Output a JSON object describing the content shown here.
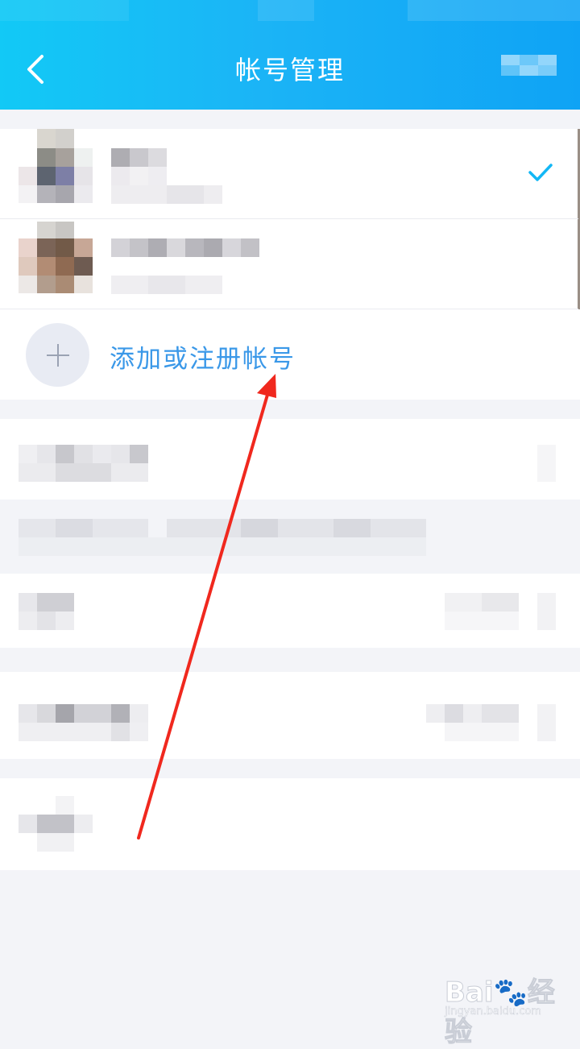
{
  "header": {
    "title": "帐号管理",
    "back_icon": "chevron-left-icon",
    "background_color": "#1bb4f6"
  },
  "accounts": {
    "items": [
      {
        "selected": true,
        "check_icon": "checkmark-icon"
      },
      {
        "selected": false
      }
    ],
    "add_label": "添加或注册帐号",
    "add_icon": "plus-icon",
    "accent_color": "#3a98e8"
  },
  "annotation": {
    "arrow_color": "#f0281e"
  },
  "watermark": {
    "brand": "Bai🐾经验",
    "url": "jingyan.baidu.com"
  }
}
